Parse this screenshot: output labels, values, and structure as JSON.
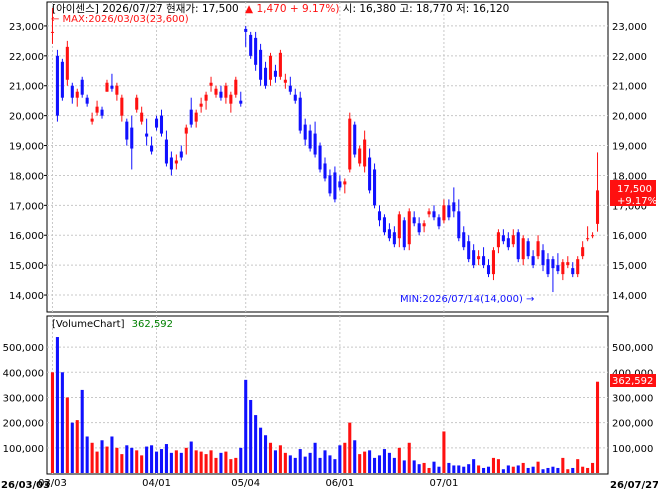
{
  "header": {
    "name": "[아이센스]",
    "date": "2026/07/27",
    "price_label": "현재가:",
    "price": "17,500",
    "change_arrow": "▲",
    "change": "1,470 + 9.17%)",
    "open_label": "시:",
    "open": "16,380",
    "high_label": "고:",
    "high": "18,770",
    "low_label": "저:",
    "low": "16,120"
  },
  "price_panel": {
    "max_note": "← MAX:2026/03/03(23,600)",
    "min_note": "MIN:2026/07/14(14,000) →",
    "current_box": [
      "17,500",
      "+9.17%"
    ],
    "y_ticks": [
      14000,
      15000,
      16000,
      17000,
      18000,
      19000,
      20000,
      21000,
      22000,
      23000
    ],
    "y_tick_labels": [
      "14,000",
      "15,000",
      "16,000",
      "17,000",
      "18,000",
      "19,000",
      "20,000",
      "21,000",
      "22,000",
      "23,000"
    ]
  },
  "volume_panel": {
    "title": "[VolumeChart]",
    "value": "362,592",
    "current_box": "362,592",
    "y_ticks": [
      100000,
      200000,
      300000,
      400000,
      500000
    ],
    "y_tick_labels": [
      "100,000",
      "200,000",
      "300,000",
      "400,000",
      "500,000"
    ]
  },
  "x_axis": {
    "start_label": "26/03/03",
    "end_label": "26/07/27",
    "month_labels": [
      "03/03",
      "04/01",
      "05/04",
      "06/01",
      "07/01"
    ],
    "month_indices": [
      0,
      21,
      39,
      58,
      79
    ]
  },
  "colors": {
    "up": "#ff1010",
    "down": "#1010ff",
    "grid": "#c8c8c8",
    "text": "#000000",
    "volume_title": "#000000",
    "volume_value": "#008000",
    "box_bg": "#ff1010"
  },
  "chart_data": {
    "type": "candlestick",
    "price_ylim": [
      13500,
      23700
    ],
    "volume_ylim": [
      0,
      560000
    ],
    "candles": [
      {
        "o": 22800,
        "h": 23600,
        "l": 22400,
        "c": 22800,
        "v": 400000
      },
      {
        "o": 22000,
        "h": 22200,
        "l": 19800,
        "c": 20000,
        "v": 540000
      },
      {
        "o": 21800,
        "h": 21900,
        "l": 20500,
        "c": 20600,
        "v": 400000
      },
      {
        "o": 21200,
        "h": 22500,
        "l": 21000,
        "c": 22300,
        "v": 300000
      },
      {
        "o": 21000,
        "h": 21100,
        "l": 20400,
        "c": 20600,
        "v": 200000
      },
      {
        "o": 20600,
        "h": 20900,
        "l": 20300,
        "c": 20800,
        "v": 210000
      },
      {
        "o": 21200,
        "h": 21300,
        "l": 20600,
        "c": 20700,
        "v": 330000
      },
      {
        "o": 20600,
        "h": 20700,
        "l": 20300,
        "c": 20400,
        "v": 145000
      },
      {
        "o": 19800,
        "h": 20100,
        "l": 19700,
        "c": 19900,
        "v": 120000
      },
      {
        "o": 20100,
        "h": 20500,
        "l": 20000,
        "c": 20300,
        "v": 85000
      },
      {
        "o": 20200,
        "h": 20300,
        "l": 19900,
        "c": 20000,
        "v": 130000
      },
      {
        "o": 20800,
        "h": 21200,
        "l": 20800,
        "c": 21100,
        "v": 105000
      },
      {
        "o": 21000,
        "h": 21400,
        "l": 20800,
        "c": 20900,
        "v": 145000
      },
      {
        "o": 20700,
        "h": 21100,
        "l": 20500,
        "c": 21000,
        "v": 100000
      },
      {
        "o": 20000,
        "h": 20700,
        "l": 19800,
        "c": 20600,
        "v": 75000
      },
      {
        "o": 19800,
        "h": 19900,
        "l": 19000,
        "c": 19200,
        "v": 110000
      },
      {
        "o": 19600,
        "h": 20000,
        "l": 18200,
        "c": 18900,
        "v": 100000
      },
      {
        "o": 20200,
        "h": 20700,
        "l": 20100,
        "c": 20600,
        "v": 90000
      },
      {
        "o": 19800,
        "h": 20300,
        "l": 19700,
        "c": 20100,
        "v": 70000
      },
      {
        "o": 19400,
        "h": 19900,
        "l": 19000,
        "c": 19300,
        "v": 105000
      },
      {
        "o": 19000,
        "h": 19300,
        "l": 18700,
        "c": 18800,
        "v": 110000
      },
      {
        "o": 19900,
        "h": 20000,
        "l": 19500,
        "c": 19600,
        "v": 85000
      },
      {
        "o": 20000,
        "h": 20200,
        "l": 19300,
        "c": 19400,
        "v": 95000
      },
      {
        "o": 19200,
        "h": 19500,
        "l": 18300,
        "c": 18400,
        "v": 115000
      },
      {
        "o": 18600,
        "h": 18800,
        "l": 18000,
        "c": 18200,
        "v": 80000
      },
      {
        "o": 18400,
        "h": 18700,
        "l": 18200,
        "c": 18500,
        "v": 90000
      },
      {
        "o": 18800,
        "h": 19000,
        "l": 18500,
        "c": 18600,
        "v": 80000
      },
      {
        "o": 19400,
        "h": 19700,
        "l": 18700,
        "c": 19600,
        "v": 100000
      },
      {
        "o": 20200,
        "h": 20600,
        "l": 19600,
        "c": 19700,
        "v": 125000
      },
      {
        "o": 19800,
        "h": 20200,
        "l": 19600,
        "c": 20100,
        "v": 90000
      },
      {
        "o": 20300,
        "h": 20600,
        "l": 20100,
        "c": 20400,
        "v": 85000
      },
      {
        "o": 20500,
        "h": 20800,
        "l": 20200,
        "c": 20700,
        "v": 75000
      },
      {
        "o": 21000,
        "h": 21300,
        "l": 20800,
        "c": 21100,
        "v": 90000
      },
      {
        "o": 20700,
        "h": 21000,
        "l": 20600,
        "c": 20900,
        "v": 60000
      },
      {
        "o": 20800,
        "h": 21000,
        "l": 20500,
        "c": 20600,
        "v": 80000
      },
      {
        "o": 20600,
        "h": 21100,
        "l": 20400,
        "c": 21000,
        "v": 85000
      },
      {
        "o": 20400,
        "h": 20800,
        "l": 20100,
        "c": 20700,
        "v": 55000
      },
      {
        "o": 20700,
        "h": 21300,
        "l": 20600,
        "c": 21200,
        "v": 60000
      },
      {
        "o": 20500,
        "h": 20800,
        "l": 20300,
        "c": 20400,
        "v": 100000
      },
      {
        "o": 22900,
        "h": 23000,
        "l": 22300,
        "c": 22800,
        "v": 370000
      },
      {
        "o": 22700,
        "h": 22800,
        "l": 21900,
        "c": 22000,
        "v": 290000
      },
      {
        "o": 22600,
        "h": 22800,
        "l": 21500,
        "c": 21700,
        "v": 230000
      },
      {
        "o": 22200,
        "h": 22400,
        "l": 21000,
        "c": 21200,
        "v": 180000
      },
      {
        "o": 21600,
        "h": 21800,
        "l": 20900,
        "c": 21000,
        "v": 150000
      },
      {
        "o": 21200,
        "h": 22100,
        "l": 21000,
        "c": 22000,
        "v": 120000
      },
      {
        "o": 21500,
        "h": 21700,
        "l": 21100,
        "c": 21300,
        "v": 90000
      },
      {
        "o": 21300,
        "h": 22200,
        "l": 21200,
        "c": 22100,
        "v": 110000
      },
      {
        "o": 21100,
        "h": 21400,
        "l": 20900,
        "c": 21200,
        "v": 80000
      },
      {
        "o": 21000,
        "h": 21300,
        "l": 20700,
        "c": 20800,
        "v": 70000
      },
      {
        "o": 20700,
        "h": 20900,
        "l": 20400,
        "c": 20500,
        "v": 60000
      },
      {
        "o": 20600,
        "h": 20800,
        "l": 19400,
        "c": 19500,
        "v": 95000
      },
      {
        "o": 19700,
        "h": 19900,
        "l": 19000,
        "c": 19200,
        "v": 65000
      },
      {
        "o": 19500,
        "h": 19700,
        "l": 18800,
        "c": 18900,
        "v": 80000
      },
      {
        "o": 19400,
        "h": 19800,
        "l": 18600,
        "c": 18700,
        "v": 120000
      },
      {
        "o": 19000,
        "h": 19100,
        "l": 18100,
        "c": 18200,
        "v": 60000
      },
      {
        "o": 18400,
        "h": 18600,
        "l": 17800,
        "c": 17900,
        "v": 90000
      },
      {
        "o": 18000,
        "h": 18200,
        "l": 17300,
        "c": 17400,
        "v": 70000
      },
      {
        "o": 18100,
        "h": 18300,
        "l": 17100,
        "c": 17200,
        "v": 55000
      },
      {
        "o": 17800,
        "h": 18000,
        "l": 17500,
        "c": 17600,
        "v": 110000
      },
      {
        "o": 17700,
        "h": 17900,
        "l": 17400,
        "c": 17800,
        "v": 120000
      },
      {
        "o": 18200,
        "h": 20100,
        "l": 18100,
        "c": 19900,
        "v": 200000
      },
      {
        "o": 19700,
        "h": 19800,
        "l": 18600,
        "c": 18700,
        "v": 130000
      },
      {
        "o": 18400,
        "h": 19000,
        "l": 18300,
        "c": 18900,
        "v": 75000
      },
      {
        "o": 18300,
        "h": 19500,
        "l": 18100,
        "c": 19200,
        "v": 85000
      },
      {
        "o": 18600,
        "h": 18900,
        "l": 17400,
        "c": 17500,
        "v": 90000
      },
      {
        "o": 18200,
        "h": 18400,
        "l": 16900,
        "c": 17000,
        "v": 60000
      },
      {
        "o": 16800,
        "h": 17000,
        "l": 16300,
        "c": 16500,
        "v": 70000
      },
      {
        "o": 16600,
        "h": 16700,
        "l": 16000,
        "c": 16100,
        "v": 95000
      },
      {
        "o": 16200,
        "h": 16400,
        "l": 15800,
        "c": 15900,
        "v": 80000
      },
      {
        "o": 16100,
        "h": 16300,
        "l": 15600,
        "c": 15700,
        "v": 60000
      },
      {
        "o": 15900,
        "h": 16800,
        "l": 15600,
        "c": 16700,
        "v": 100000
      },
      {
        "o": 16500,
        "h": 16600,
        "l": 15500,
        "c": 15600,
        "v": 50000
      },
      {
        "o": 15700,
        "h": 16900,
        "l": 15500,
        "c": 16800,
        "v": 120000
      },
      {
        "o": 16600,
        "h": 16800,
        "l": 16300,
        "c": 16400,
        "v": 50000
      },
      {
        "o": 16400,
        "h": 16600,
        "l": 16000,
        "c": 16100,
        "v": 35000
      },
      {
        "o": 16300,
        "h": 16500,
        "l": 16100,
        "c": 16400,
        "v": 40000
      },
      {
        "o": 16700,
        "h": 16900,
        "l": 16600,
        "c": 16800,
        "v": 20000
      },
      {
        "o": 16800,
        "h": 17000,
        "l": 16500,
        "c": 16600,
        "v": 45000
      },
      {
        "o": 16600,
        "h": 16700,
        "l": 16200,
        "c": 16300,
        "v": 25000
      },
      {
        "o": 16500,
        "h": 17200,
        "l": 16400,
        "c": 17000,
        "v": 165000
      },
      {
        "o": 17000,
        "h": 17200,
        "l": 16500,
        "c": 16600,
        "v": 40000
      },
      {
        "o": 17100,
        "h": 17600,
        "l": 16600,
        "c": 16800,
        "v": 30000
      },
      {
        "o": 16800,
        "h": 17200,
        "l": 15800,
        "c": 15900,
        "v": 30000
      },
      {
        "o": 16100,
        "h": 16300,
        "l": 15500,
        "c": 15600,
        "v": 25000
      },
      {
        "o": 15800,
        "h": 16000,
        "l": 15100,
        "c": 15200,
        "v": 35000
      },
      {
        "o": 15500,
        "h": 15700,
        "l": 14900,
        "c": 15000,
        "v": 55000
      },
      {
        "o": 15200,
        "h": 15500,
        "l": 15000,
        "c": 15300,
        "v": 30000
      },
      {
        "o": 15300,
        "h": 15600,
        "l": 14900,
        "c": 15000,
        "v": 20000
      },
      {
        "o": 15000,
        "h": 15200,
        "l": 14600,
        "c": 14700,
        "v": 25000
      },
      {
        "o": 14700,
        "h": 15600,
        "l": 14500,
        "c": 15500,
        "v": 60000
      },
      {
        "o": 15600,
        "h": 16200,
        "l": 15400,
        "c": 16100,
        "v": 55000
      },
      {
        "o": 16000,
        "h": 16200,
        "l": 15700,
        "c": 15800,
        "v": 15000
      },
      {
        "o": 15900,
        "h": 16100,
        "l": 15500,
        "c": 15600,
        "v": 30000
      },
      {
        "o": 15700,
        "h": 16200,
        "l": 15600,
        "c": 16000,
        "v": 25000
      },
      {
        "o": 16100,
        "h": 16200,
        "l": 15100,
        "c": 15200,
        "v": 30000
      },
      {
        "o": 15200,
        "h": 16000,
        "l": 15000,
        "c": 15900,
        "v": 40000
      },
      {
        "o": 15800,
        "h": 15900,
        "l": 15200,
        "c": 15300,
        "v": 20000
      },
      {
        "o": 15300,
        "h": 15500,
        "l": 14900,
        "c": 15000,
        "v": 25000
      },
      {
        "o": 15300,
        "h": 16000,
        "l": 15200,
        "c": 15800,
        "v": 45000
      },
      {
        "o": 15500,
        "h": 15700,
        "l": 14800,
        "c": 15000,
        "v": 15000
      },
      {
        "o": 15200,
        "h": 15400,
        "l": 14600,
        "c": 14700,
        "v": 20000
      },
      {
        "o": 15200,
        "h": 15300,
        "l": 14100,
        "c": 14900,
        "v": 25000
      },
      {
        "o": 15000,
        "h": 15400,
        "l": 14700,
        "c": 14800,
        "v": 20000
      },
      {
        "o": 14700,
        "h": 15200,
        "l": 14500,
        "c": 15100,
        "v": 60000
      },
      {
        "o": 15000,
        "h": 15300,
        "l": 14900,
        "c": 15100,
        "v": 15000
      },
      {
        "o": 14900,
        "h": 15100,
        "l": 14600,
        "c": 14700,
        "v": 20000
      },
      {
        "o": 14700,
        "h": 15300,
        "l": 14600,
        "c": 15200,
        "v": 55000
      },
      {
        "o": 15300,
        "h": 15800,
        "l": 15200,
        "c": 15600,
        "v": 25000
      },
      {
        "o": 15900,
        "h": 16300,
        "l": 15800,
        "c": 15900,
        "v": 20000
      },
      {
        "o": 16000,
        "h": 16100,
        "l": 15900,
        "c": 16000,
        "v": 40000
      },
      {
        "o": 16380,
        "h": 18770,
        "l": 16120,
        "c": 17500,
        "v": 362592
      }
    ]
  }
}
